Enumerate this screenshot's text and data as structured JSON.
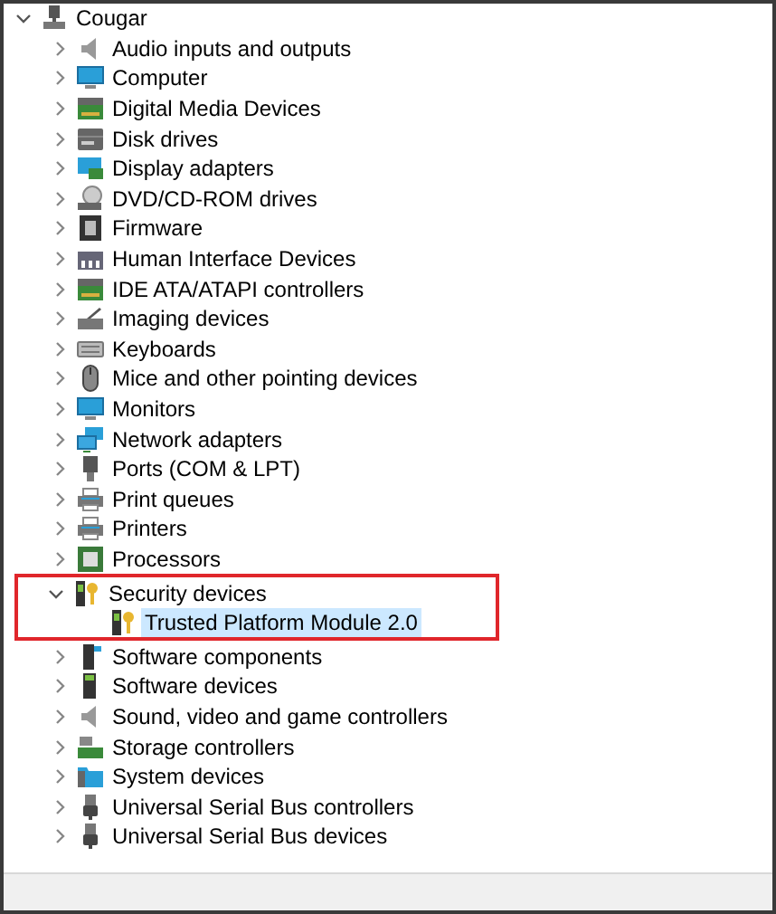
{
  "tree": [
    {
      "label": "Cougar",
      "expanded": true,
      "selected": false,
      "children": [
        {
          "label": "Audio inputs and outputs",
          "expanded": false,
          "selected": false
        },
        {
          "label": "Computer",
          "expanded": false,
          "selected": false
        },
        {
          "label": "Digital Media Devices",
          "expanded": false,
          "selected": false
        },
        {
          "label": "Disk drives",
          "expanded": false,
          "selected": false
        },
        {
          "label": "Display adapters",
          "expanded": false,
          "selected": false
        },
        {
          "label": "DVD/CD-ROM drives",
          "expanded": false,
          "selected": false
        },
        {
          "label": "Firmware",
          "expanded": false,
          "selected": false
        },
        {
          "label": "Human Interface Devices",
          "expanded": false,
          "selected": false
        },
        {
          "label": "IDE ATA/ATAPI controllers",
          "expanded": false,
          "selected": false
        },
        {
          "label": "Imaging devices",
          "expanded": false,
          "selected": false
        },
        {
          "label": "Keyboards",
          "expanded": false,
          "selected": false
        },
        {
          "label": "Mice and other pointing devices",
          "expanded": false,
          "selected": false
        },
        {
          "label": "Monitors",
          "expanded": false,
          "selected": false
        },
        {
          "label": "Network adapters",
          "expanded": false,
          "selected": false
        },
        {
          "label": "Ports (COM & LPT)",
          "expanded": false,
          "selected": false
        },
        {
          "label": "Print queues",
          "expanded": false,
          "selected": false
        },
        {
          "label": "Printers",
          "expanded": false,
          "selected": false
        },
        {
          "label": "Processors",
          "expanded": false,
          "selected": false
        },
        {
          "label": "Security devices",
          "expanded": true,
          "selected": false,
          "highlighted": true,
          "children": [
            {
              "label": "Trusted Platform Module 2.0",
              "selected": true
            }
          ]
        },
        {
          "label": "Software components",
          "expanded": false,
          "selected": false
        },
        {
          "label": "Software devices",
          "expanded": false,
          "selected": false
        },
        {
          "label": "Sound, video and game controllers",
          "expanded": false,
          "selected": false
        },
        {
          "label": "Storage controllers",
          "expanded": false,
          "selected": false
        },
        {
          "label": "System devices",
          "expanded": false,
          "selected": false
        },
        {
          "label": "Universal Serial Bus controllers",
          "expanded": false,
          "selected": false
        },
        {
          "label": "Universal Serial Bus devices",
          "expanded": false,
          "selected": false
        }
      ]
    }
  ]
}
